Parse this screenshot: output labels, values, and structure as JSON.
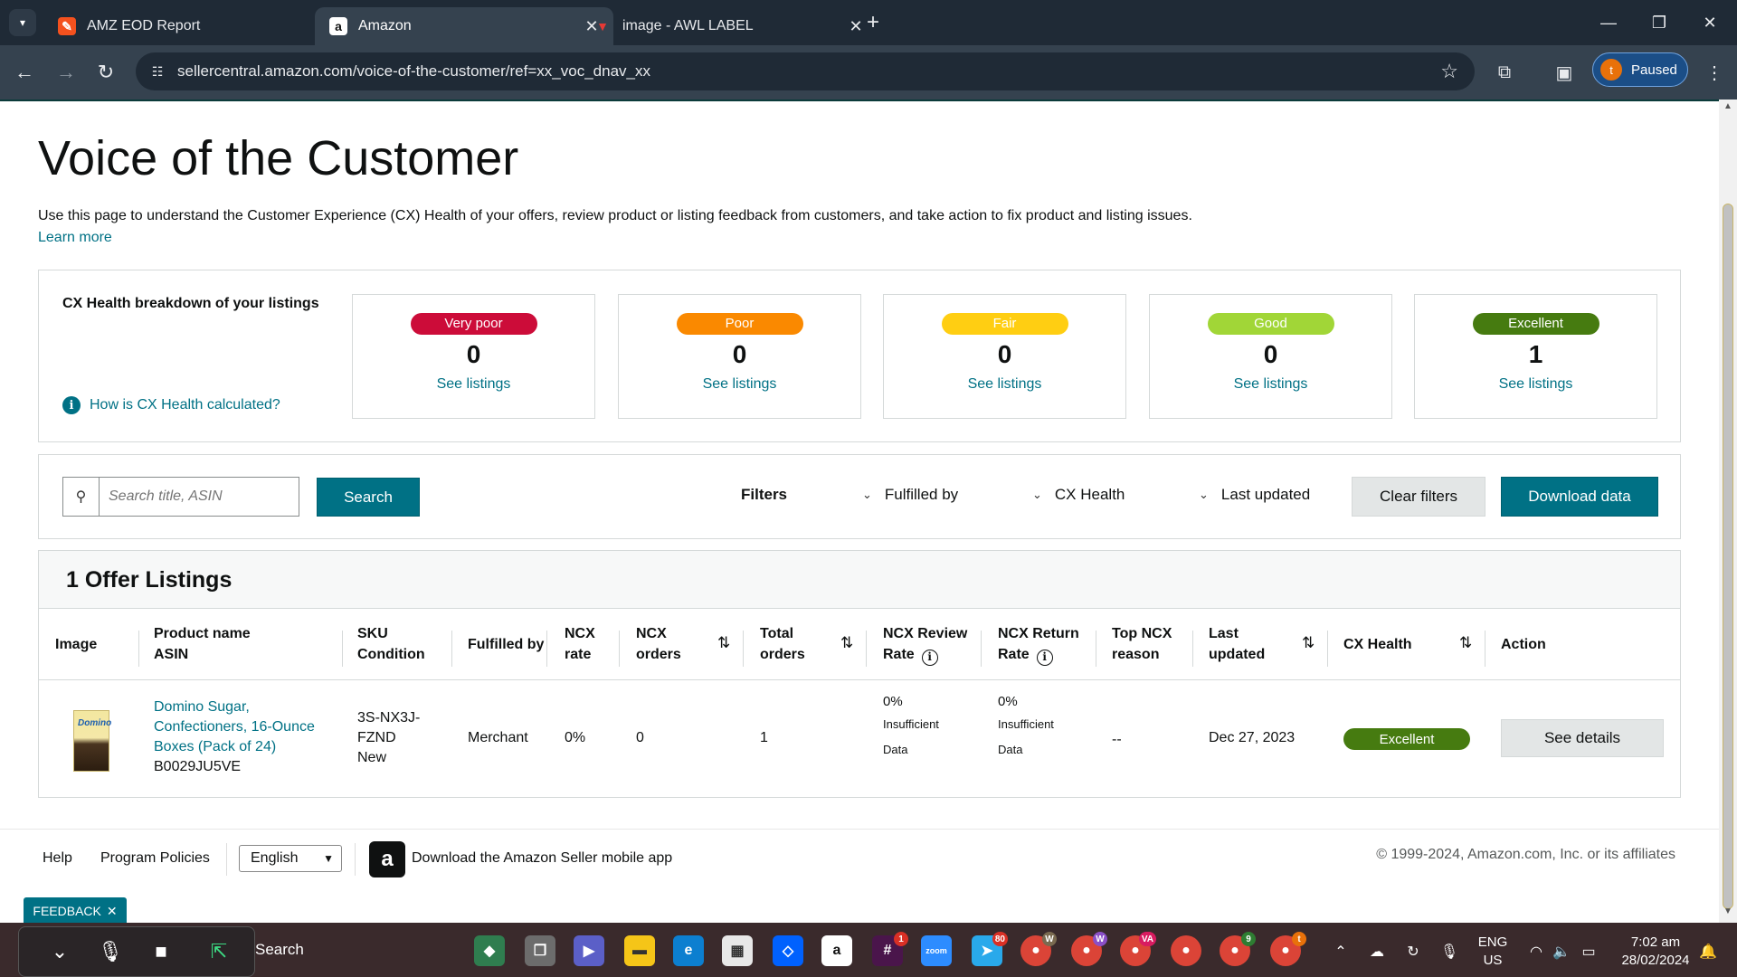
{
  "browser": {
    "tabs": [
      {
        "title": "AMZ EOD Report",
        "active": false
      },
      {
        "title": "Amazon",
        "active": true
      },
      {
        "title": "image - AWL LABEL",
        "active": false
      }
    ],
    "url": "sellercentral.amazon.com/voice-of-the-customer/ref=xx_voc_dnav_xx",
    "profile_initial": "t",
    "profile_label": "Paused"
  },
  "page": {
    "title": "Voice of the Customer",
    "description": "Use this page to understand the Customer Experience (CX) Health of your offers, review product or listing feedback from customers, and take action to fix product and listing issues.",
    "learn_more": "Learn more"
  },
  "cx_health": {
    "title": "CX Health breakdown of your listings",
    "help_link": "How is CX Health calculated?",
    "tiles": [
      {
        "label": "Very poor",
        "count": "0",
        "link": "See listings",
        "color": "#cc0c39"
      },
      {
        "label": "Poor",
        "count": "0",
        "link": "See listings",
        "color": "#fa8900"
      },
      {
        "label": "Fair",
        "count": "0",
        "link": "See listings",
        "color": "#ffce12"
      },
      {
        "label": "Good",
        "count": "0",
        "link": "See listings",
        "color": "#a1d637"
      },
      {
        "label": "Excellent",
        "count": "1",
        "link": "See listings",
        "color": "#467b10"
      }
    ]
  },
  "filters": {
    "search_placeholder": "Search title, ASIN",
    "search_button": "Search",
    "label": "Filters",
    "dropdowns": [
      "Fulfilled by",
      "CX Health",
      "Last updated"
    ],
    "clear_button": "Clear filters",
    "download_button": "Download data"
  },
  "listings": {
    "heading": "1 Offer Listings",
    "columns": {
      "image": "Image",
      "product_name": "Product name",
      "asin": "ASIN",
      "sku": "SKU",
      "condition": "Condition",
      "fulfilled_by": "Fulfilled by",
      "ncx_rate_1": "NCX",
      "ncx_rate_2": "rate",
      "ncx_orders_1": "NCX",
      "ncx_orders_2": "orders",
      "total_orders_1": "Total",
      "total_orders_2": "orders",
      "ncx_review_1": "NCX Review",
      "ncx_review_2": "Rate",
      "ncx_return_1": "NCX Return",
      "ncx_return_2": "Rate",
      "top_ncx_1": "Top NCX",
      "top_ncx_2": "reason",
      "last_updated_1": "Last",
      "last_updated_2": "updated",
      "cx_health": "CX Health",
      "action": "Action"
    },
    "rows": [
      {
        "product_line1": "Domino Sugar,",
        "product_line2": "Confectioners, 16-Ounce",
        "product_line3": "Boxes (Pack of 24)",
        "asin": "B0029JU5VE",
        "sku_line1": "3S-NX3J-",
        "sku_line2": "FZND",
        "condition": "New",
        "fulfilled_by": "Merchant",
        "ncx_rate": "0%",
        "ncx_orders": "0",
        "total_orders": "1",
        "review_rate": "0%",
        "review_note1": "Insufficient",
        "review_note2": "Data",
        "return_rate": "0%",
        "return_note1": "Insufficient",
        "return_note2": "Data",
        "top_reason": "--",
        "last_updated": "Dec 27, 2023",
        "cx_health": "Excellent",
        "action": "See details",
        "thumb_brand": "Domino"
      }
    ]
  },
  "footer": {
    "help": "Help",
    "policies": "Program Policies",
    "language": "English",
    "app_text": "Download the Amazon Seller mobile app",
    "copyright": "© 1999-2024, Amazon.com, Inc. or its affiliates",
    "feedback": "FEEDBACK"
  },
  "taskbar": {
    "search": "Search",
    "lang_1": "ENG",
    "lang_2": "US",
    "time": "7:02 am",
    "date": "28/02/2024",
    "badges": {
      "slack": "1",
      "telegram": "80",
      "chrome1": "W",
      "chrome2": "W",
      "chrome3": "VA",
      "chrome5": "9",
      "chrome6": "t"
    }
  }
}
